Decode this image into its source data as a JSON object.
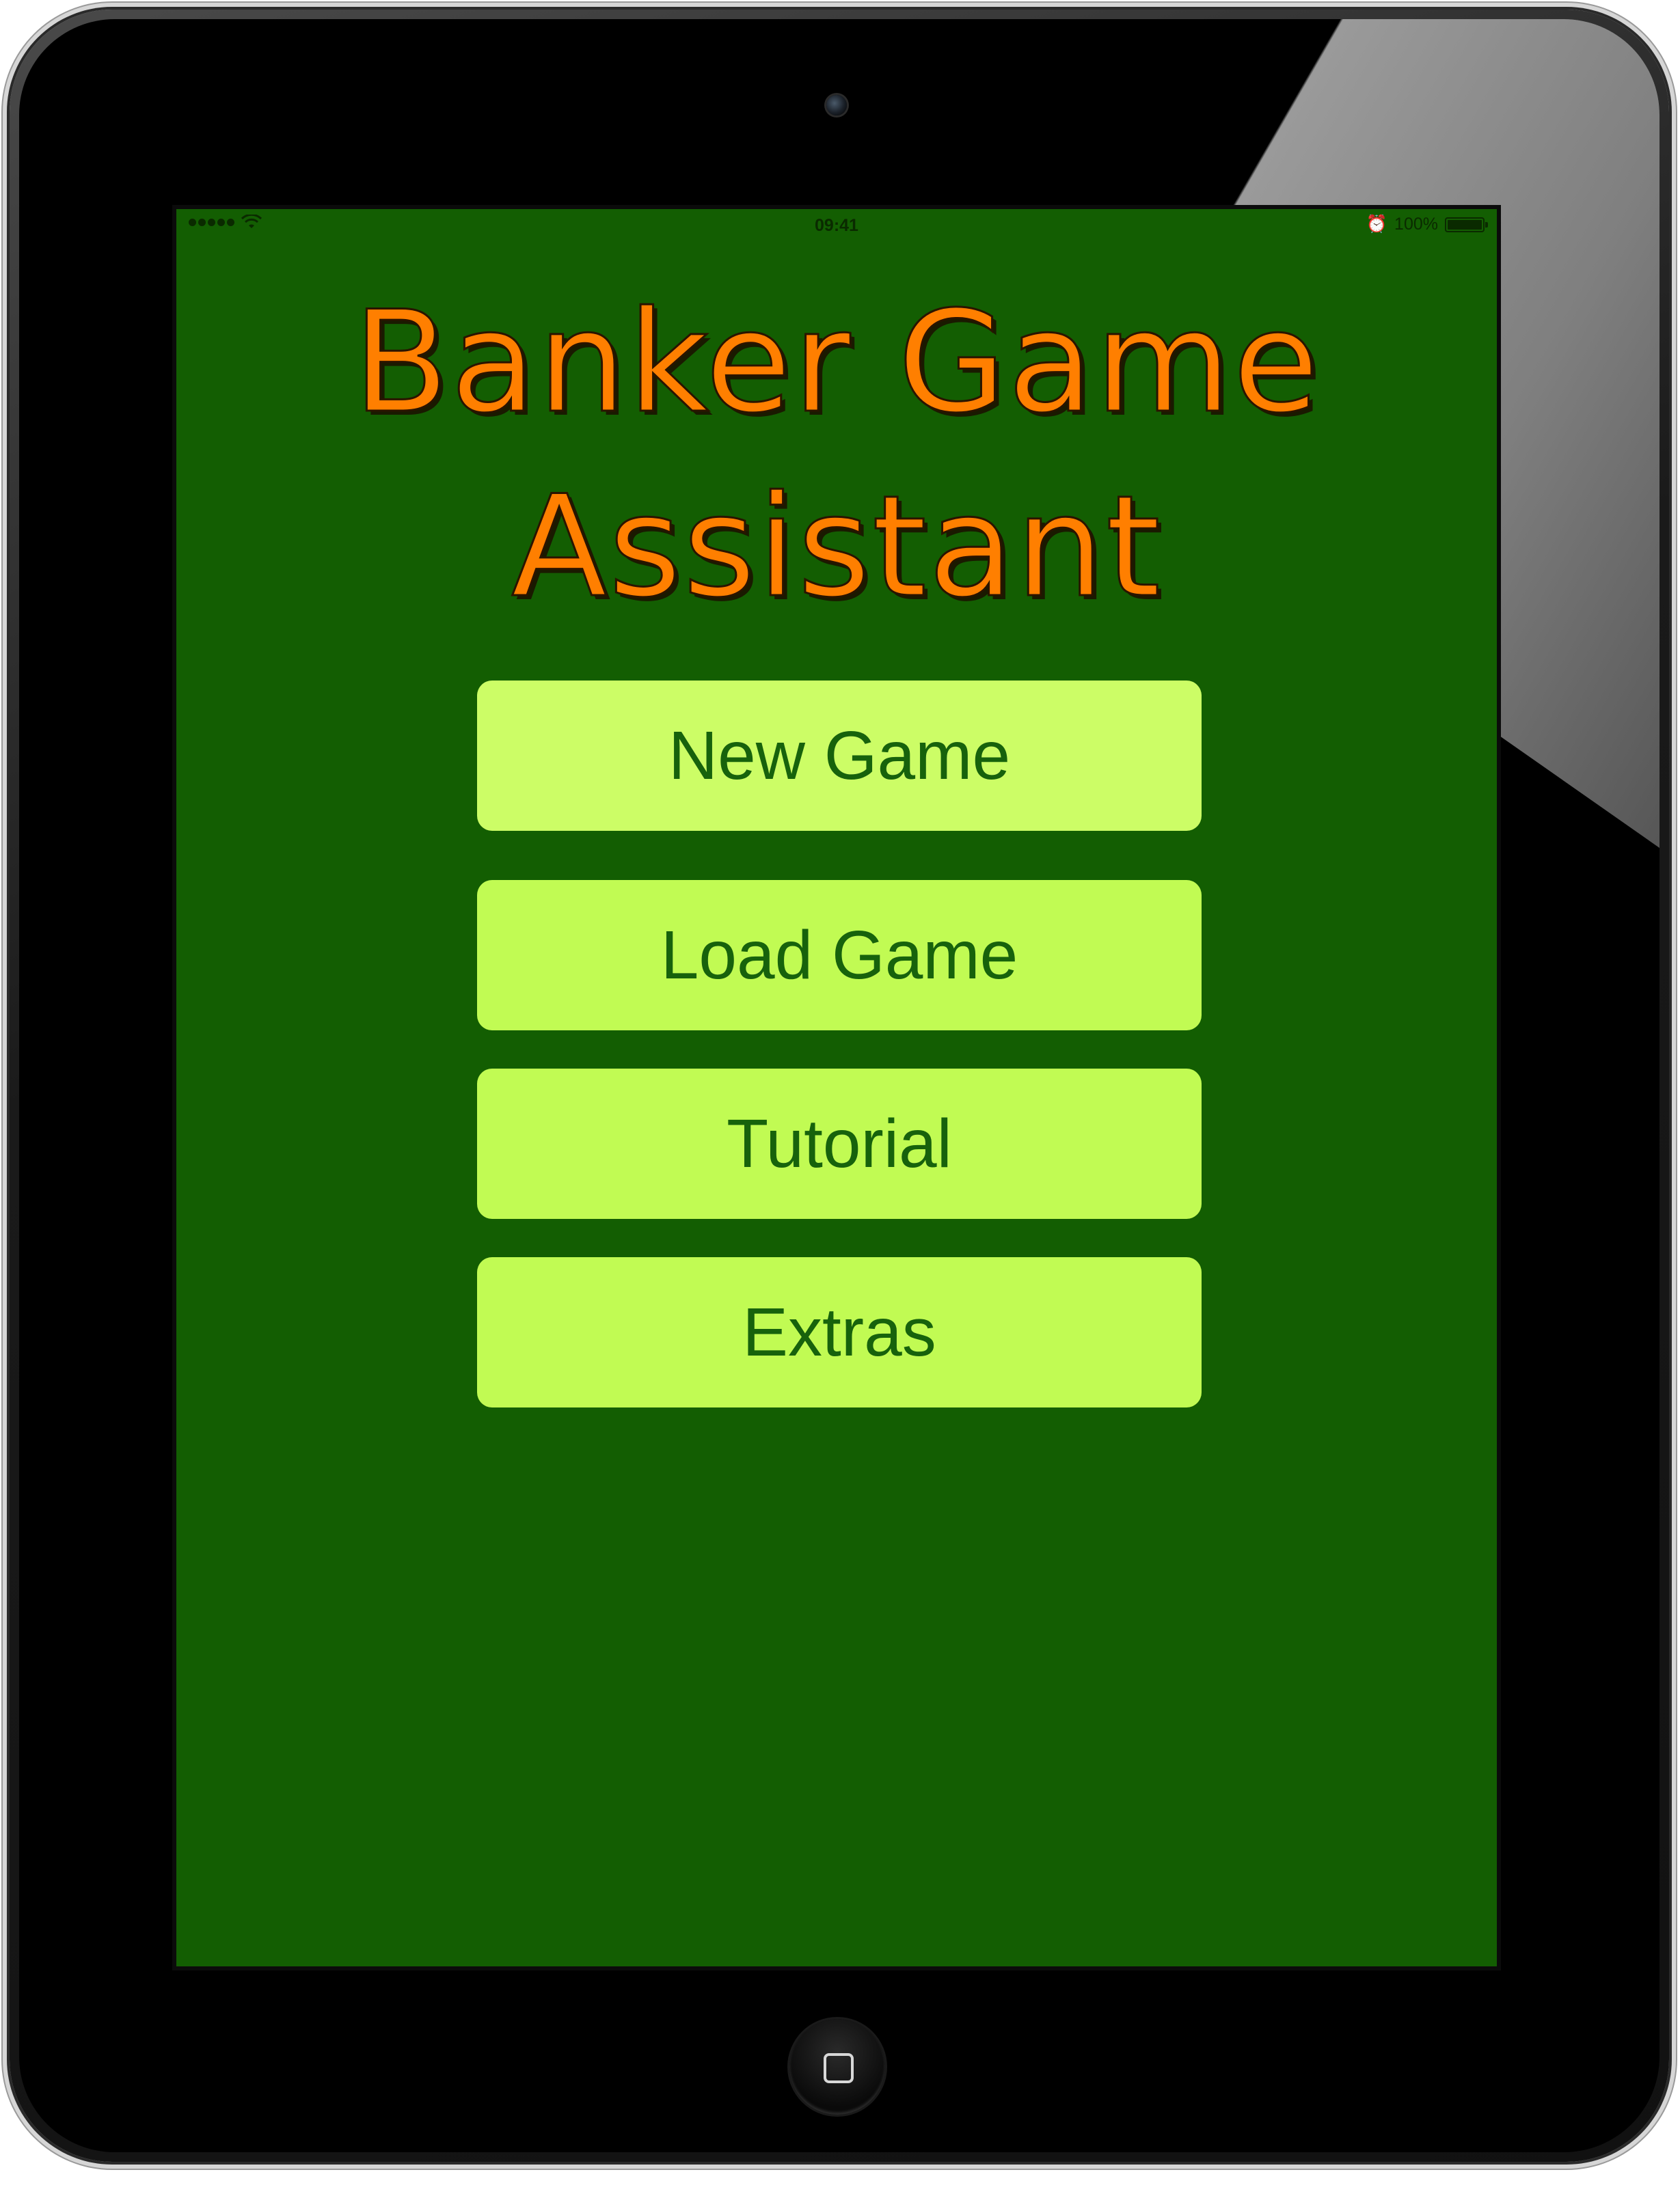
{
  "status_bar": {
    "time": "09:41",
    "battery_text": "100%",
    "battery_level": 1.0
  },
  "app": {
    "title_line1": "Banker Game",
    "title_line2": "Assistant"
  },
  "menu": {
    "items": [
      {
        "label": "New Game"
      },
      {
        "label": "Load Game"
      },
      {
        "label": "Tutorial"
      },
      {
        "label": "Extras"
      }
    ]
  },
  "colors": {
    "screen_background": "#135e02",
    "title_orange": "#ff7f00",
    "button_background": "#c1fb53",
    "button_text": "#17620c"
  }
}
